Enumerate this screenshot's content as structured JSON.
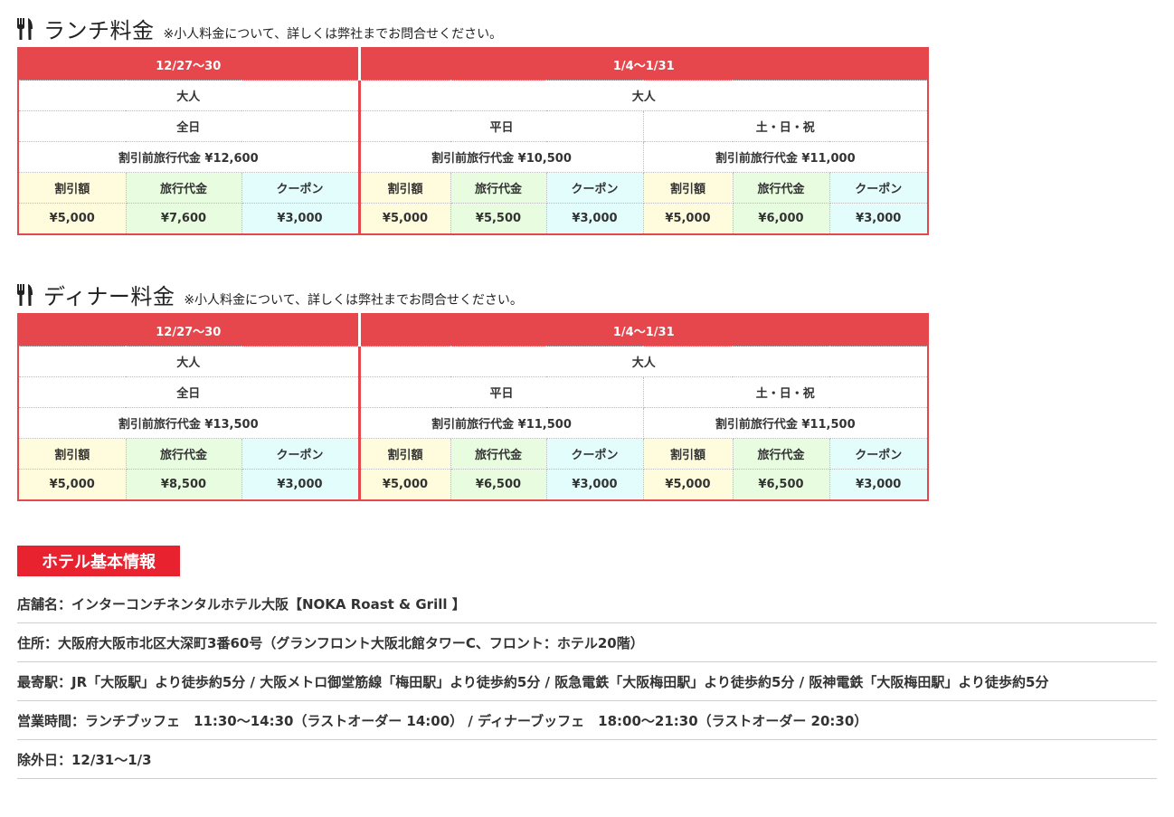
{
  "lunch": {
    "title": "ランチ料金",
    "note": "※小人料金について、詳しくは弊社までお問合せください。",
    "period1": "12/27〜30",
    "period2": "1/4〜1/31",
    "adult": "大人",
    "allday": "全日",
    "weekday": "平日",
    "weekend": "土・日・祝",
    "price_allday": "割引前旅行代金 ¥12,600",
    "price_weekday": "割引前旅行代金 ¥10,500",
    "price_weekend": "割引前旅行代金 ¥11,000",
    "col_discount": "割引額",
    "col_travel": "旅行代金",
    "col_coupon": "クーポン",
    "values": [
      "¥5,000",
      "¥7,600",
      "¥3,000",
      "¥5,000",
      "¥5,500",
      "¥3,000",
      "¥5,000",
      "¥6,000",
      "¥3,000"
    ]
  },
  "dinner": {
    "title": "ディナー料金",
    "note": "※小人料金について、詳しくは弊社までお問合せください。",
    "period1": "12/27〜30",
    "period2": "1/4〜1/31",
    "adult": "大人",
    "allday": "全日",
    "weekday": "平日",
    "weekend": "土・日・祝",
    "price_allday": "割引前旅行代金 ¥13,500",
    "price_weekday": "割引前旅行代金 ¥11,500",
    "price_weekend": "割引前旅行代金 ¥11,500",
    "col_discount": "割引額",
    "col_travel": "旅行代金",
    "col_coupon": "クーポン",
    "values": [
      "¥5,000",
      "¥8,500",
      "¥3,000",
      "¥5,000",
      "¥6,500",
      "¥3,000",
      "¥5,000",
      "¥6,500",
      "¥3,000"
    ]
  },
  "hotel": {
    "badge": "ホテル基本情報",
    "rows": [
      "店舗名：インターコンチネンタルホテル大阪【NOKA Roast & Grill 】",
      "住所：大阪府大阪市北区大深町3番60号（グランフロント大阪北館タワーC、フロント：ホテル20階）",
      "最寄駅：JR「大阪駅」より徒歩約5分 / 大阪メトロ御堂筋線「梅田駅」より徒歩約5分 / 阪急電鉄「大阪梅田駅」より徒歩約5分 / 阪神電鉄「大阪梅田駅」より徒歩約5分",
      "営業時間：ランチブッフェ　11:30〜14:30（ラストオーダー 14:00） / ディナーブッフェ　18:00〜21:30（ラストオーダー 20:30）",
      "除外日：12/31〜1/3"
    ]
  },
  "colors": {
    "accent": "#e6474d",
    "badge": "#e8222f",
    "yellow": "#fffbdd",
    "green": "#e8fde0",
    "cyan": "#e3fdfd"
  },
  "icons": {
    "section": "fork-knife-icon"
  }
}
